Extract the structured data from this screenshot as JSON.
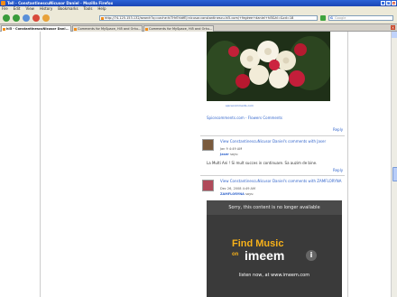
{
  "window": {
    "title": "Tell - ConstantinescuNicusor Daniel - Mozilla Firefox",
    "controls": [
      "_",
      "□",
      "×"
    ]
  },
  "menu": [
    "File",
    "Edit",
    "View",
    "History",
    "Bookmarks",
    "Tools",
    "Help"
  ],
  "nav": {
    "url": "http://74.125.153.132/search?q=cache:hi7HrEhldfEJ:nicusor.constantinescu.hi5.com/+fegiree+daniel+hi5&hl=&cd=18",
    "search_placeholder": "Google"
  },
  "tabs": [
    {
      "label": "hi5 - ConstantinescuNicusor Dani...",
      "active": true
    },
    {
      "label": "Comments for MySpace, Hi5 and Orku...",
      "active": false
    },
    {
      "label": "Comments for MySpace, Hi5 and Orku...",
      "active": false
    }
  ],
  "content": {
    "photo_caption": "spicecomments.com",
    "photo_link": "Spicecomments.com - Flowers Comments",
    "reply_label": "Reply",
    "comments": [
      {
        "heading": "View ConstantinescuNicusor Daniel's comments with Jaser",
        "date": "Jan 9 4:49 AM",
        "user": "Jaser",
        "says": "says:",
        "text": "La Multi Ani ! Si mult succes in continuare. Sa auzim de bine."
      },
      {
        "heading": "View ConstantinescuNicusor Daniel's comments with ZAMFLORYNA",
        "date": "Dec 26, 2008 4:49 AM",
        "user": "ZAMFLORYNA",
        "says": "says:",
        "text": ""
      }
    ],
    "imeem": {
      "notice": "Sorry, this content is no longer available",
      "find_music": "Find Music",
      "on": "on",
      "logo": "imeem",
      "bubble": "i",
      "listen": "listen now, at www.imeem.com"
    }
  }
}
